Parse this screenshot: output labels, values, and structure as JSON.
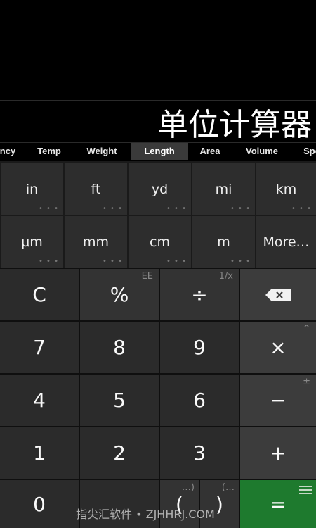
{
  "display": {
    "value": "单位计算器"
  },
  "tabs": [
    {
      "label": "ncy"
    },
    {
      "label": "Temp"
    },
    {
      "label": "Weight"
    },
    {
      "label": "Length",
      "active": true
    },
    {
      "label": "Area"
    },
    {
      "label": "Volume"
    },
    {
      "label": "Spe"
    }
  ],
  "units": [
    {
      "label": "in",
      "dots": "• • •"
    },
    {
      "label": "ft",
      "dots": "• • •"
    },
    {
      "label": "yd",
      "dots": "• • •"
    },
    {
      "label": "mi",
      "dots": "• • •"
    },
    {
      "label": "km",
      "dots": "• • •"
    },
    {
      "label": "µm",
      "dots": "• • •"
    },
    {
      "label": "mm",
      "dots": "• • •"
    },
    {
      "label": "cm",
      "dots": "• • •"
    },
    {
      "label": "m",
      "dots": "• • •"
    },
    {
      "label": "More…"
    }
  ],
  "keys": {
    "clear": "C",
    "percent": "%",
    "percent_sup": "EE",
    "divide": "÷",
    "divide_sup": "1/x",
    "backspace_icon": "backspace-icon",
    "seven": "7",
    "eight": "8",
    "nine": "9",
    "multiply": "×",
    "multiply_sup": "^",
    "four": "4",
    "five": "5",
    "six": "6",
    "minus": "−",
    "minus_sup": "±",
    "one": "1",
    "two": "2",
    "three": "3",
    "plus": "+",
    "zero": "0",
    "paren_open": "(",
    "paren_open_sup": "…)",
    "paren_close": ")",
    "paren_close_sup": "(…",
    "equals": "="
  },
  "watermark": "指尖汇软件 • ZJHHRJ.COM",
  "colors": {
    "accent_equals": "#1e7a2e",
    "active_tab": "#3a3a3a"
  }
}
